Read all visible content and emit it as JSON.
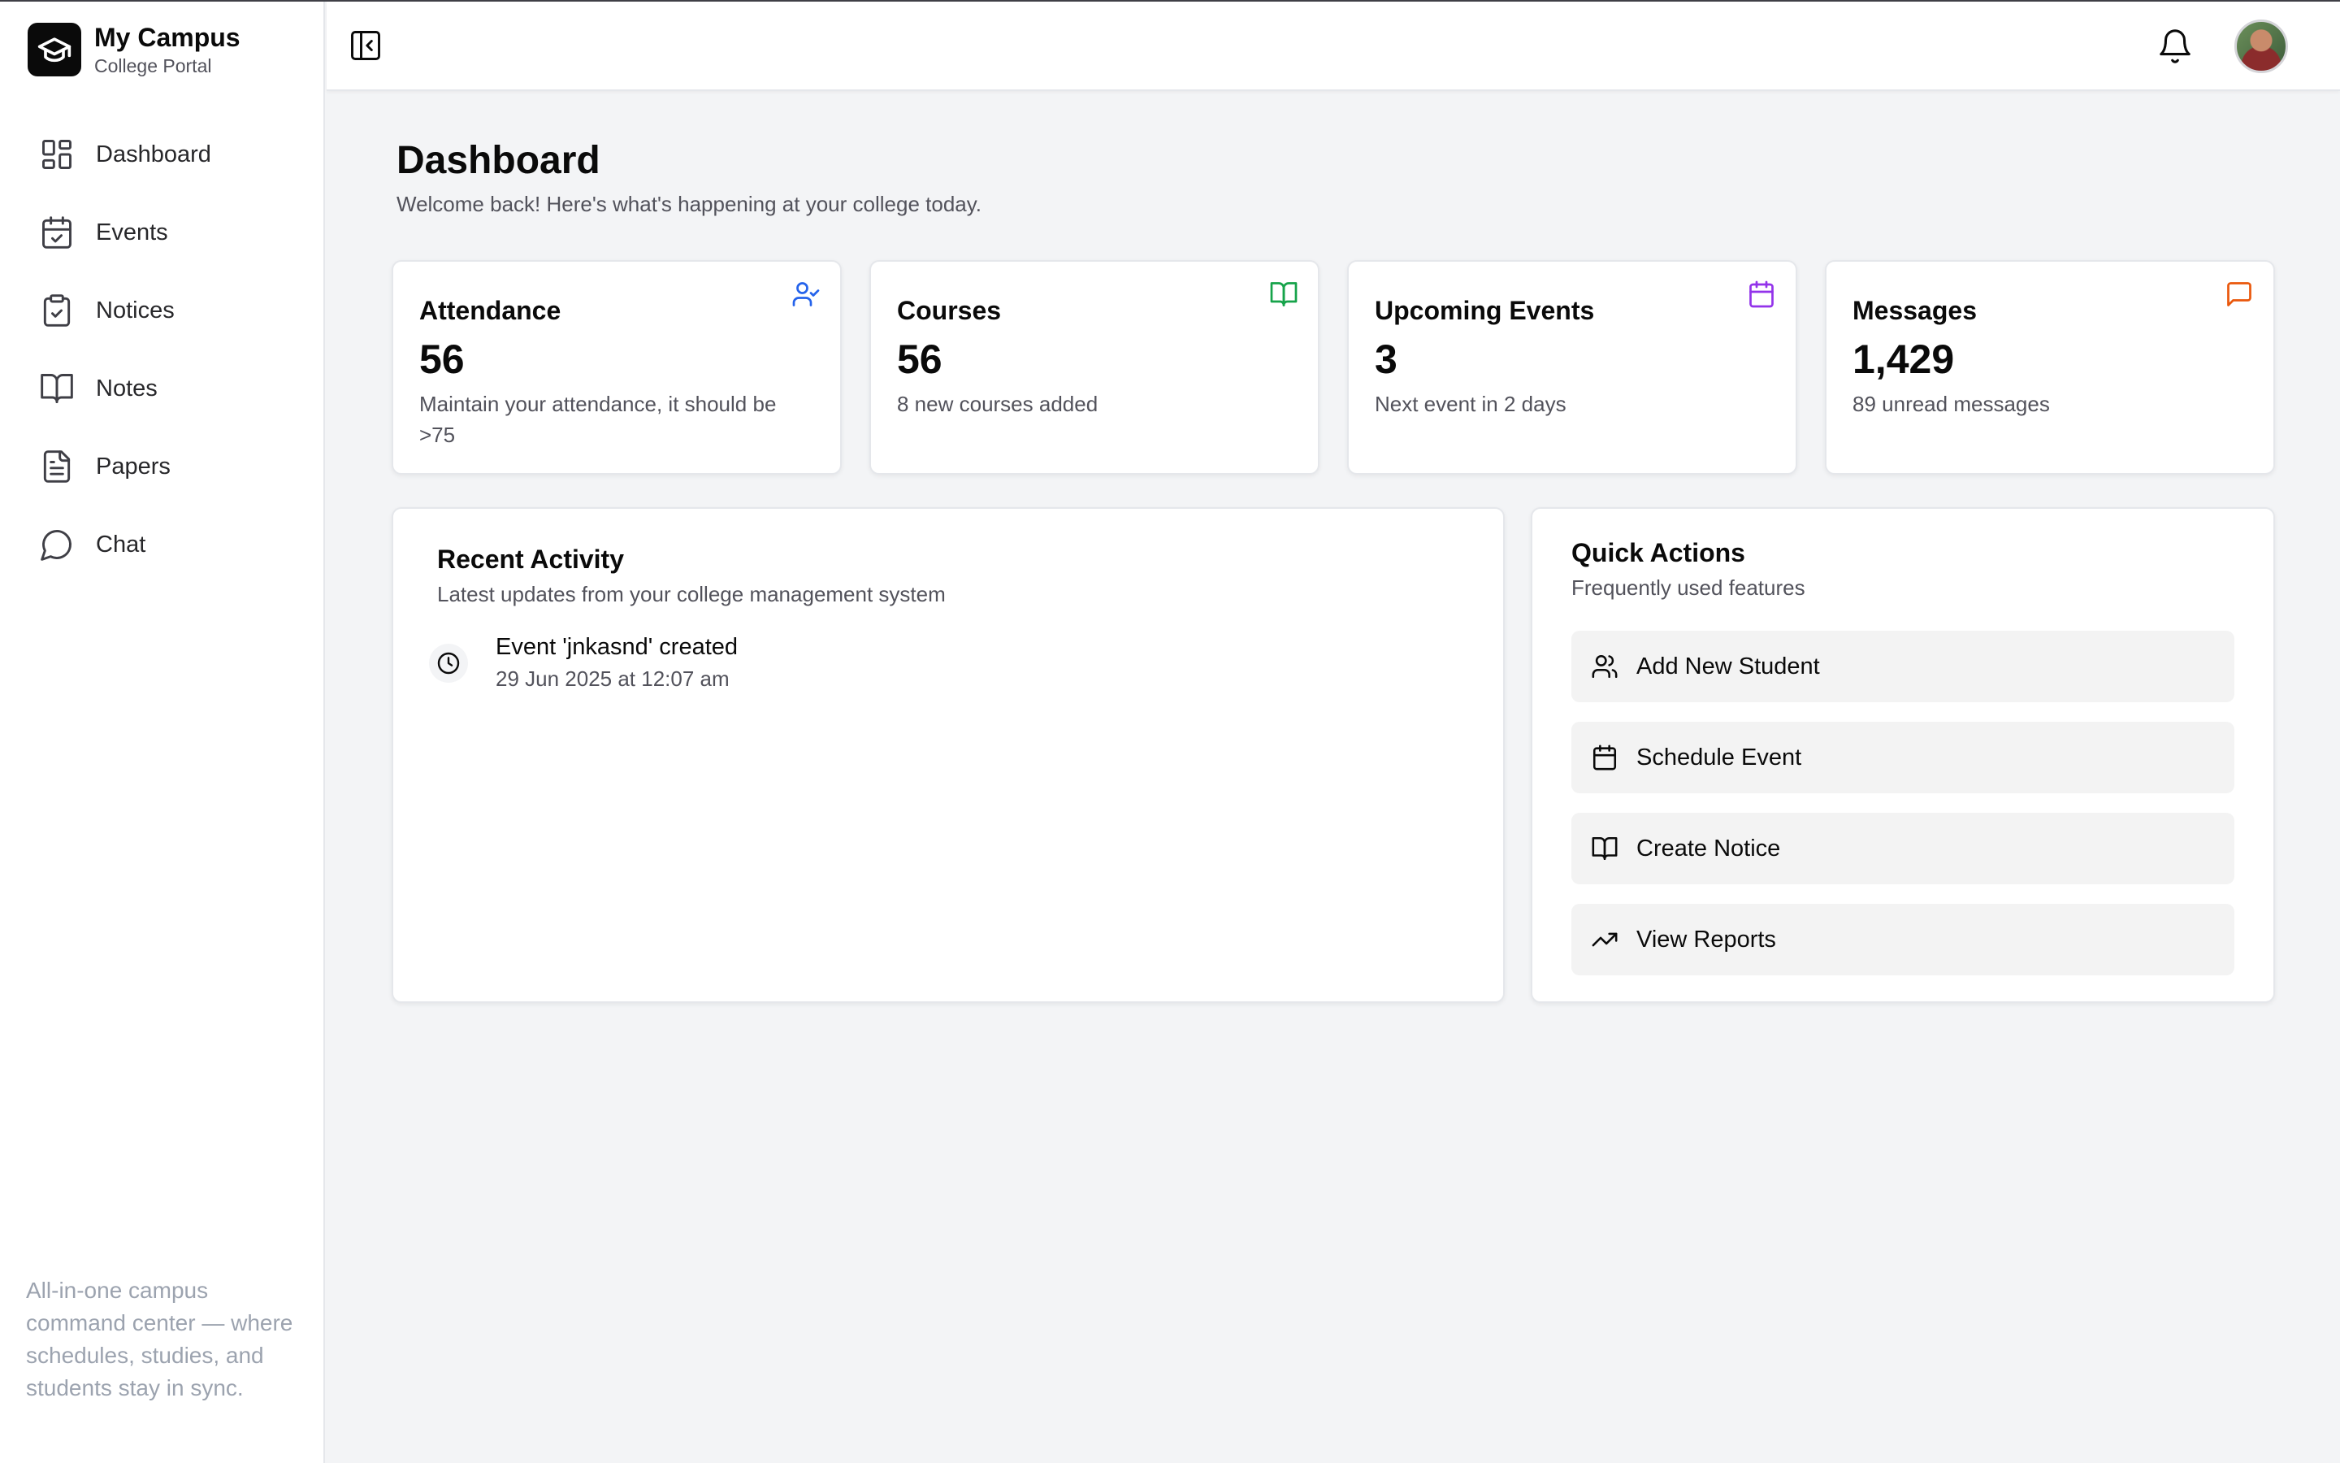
{
  "brand": {
    "title": "My Campus",
    "subtitle": "College Portal",
    "icon": "graduation-cap-icon"
  },
  "sidebar": {
    "items": [
      {
        "label": "Dashboard",
        "icon": "layout-dashboard-icon"
      },
      {
        "label": "Events",
        "icon": "calendar-check-icon"
      },
      {
        "label": "Notices",
        "icon": "clipboard-check-icon"
      },
      {
        "label": "Notes",
        "icon": "book-open-icon"
      },
      {
        "label": "Papers",
        "icon": "file-text-icon"
      },
      {
        "label": "Chat",
        "icon": "message-circle-icon"
      }
    ],
    "footer": "All-in-one campus command center — where schedules, studies, and students stay in sync."
  },
  "header": {
    "toggle_icon": "panel-left-close-icon",
    "bell_icon": "bell-icon",
    "avatar": "user-avatar"
  },
  "page": {
    "title": "Dashboard",
    "subtitle": "Welcome back! Here's what's happening at your college today."
  },
  "stats": [
    {
      "title": "Attendance",
      "value": "56",
      "desc": "Maintain your attendance, it should be >75",
      "icon": "user-check-icon",
      "color": "#2563eb"
    },
    {
      "title": "Courses",
      "value": "56",
      "desc": "8 new courses added",
      "icon": "book-open-icon",
      "color": "#16a34a"
    },
    {
      "title": "Upcoming Events",
      "value": "3",
      "desc": "Next event in 2 days",
      "icon": "calendar-icon",
      "color": "#9333ea"
    },
    {
      "title": "Messages",
      "value": "1,429",
      "desc": "89 unread messages",
      "icon": "message-square-icon",
      "color": "#ea580c"
    }
  ],
  "recent_activity": {
    "title": "Recent Activity",
    "subtitle": "Latest updates from your college management system",
    "items": [
      {
        "title": "Event 'jnkasnd' created",
        "time": "29 Jun 2025 at 12:07 am",
        "icon": "clock-icon"
      }
    ]
  },
  "quick_actions": {
    "title": "Quick Actions",
    "subtitle": "Frequently used features",
    "items": [
      {
        "label": "Add New Student",
        "icon": "users-icon"
      },
      {
        "label": "Schedule Event",
        "icon": "calendar-icon"
      },
      {
        "label": "Create Notice",
        "icon": "book-open-icon"
      },
      {
        "label": "View Reports",
        "icon": "trending-up-icon"
      }
    ]
  }
}
